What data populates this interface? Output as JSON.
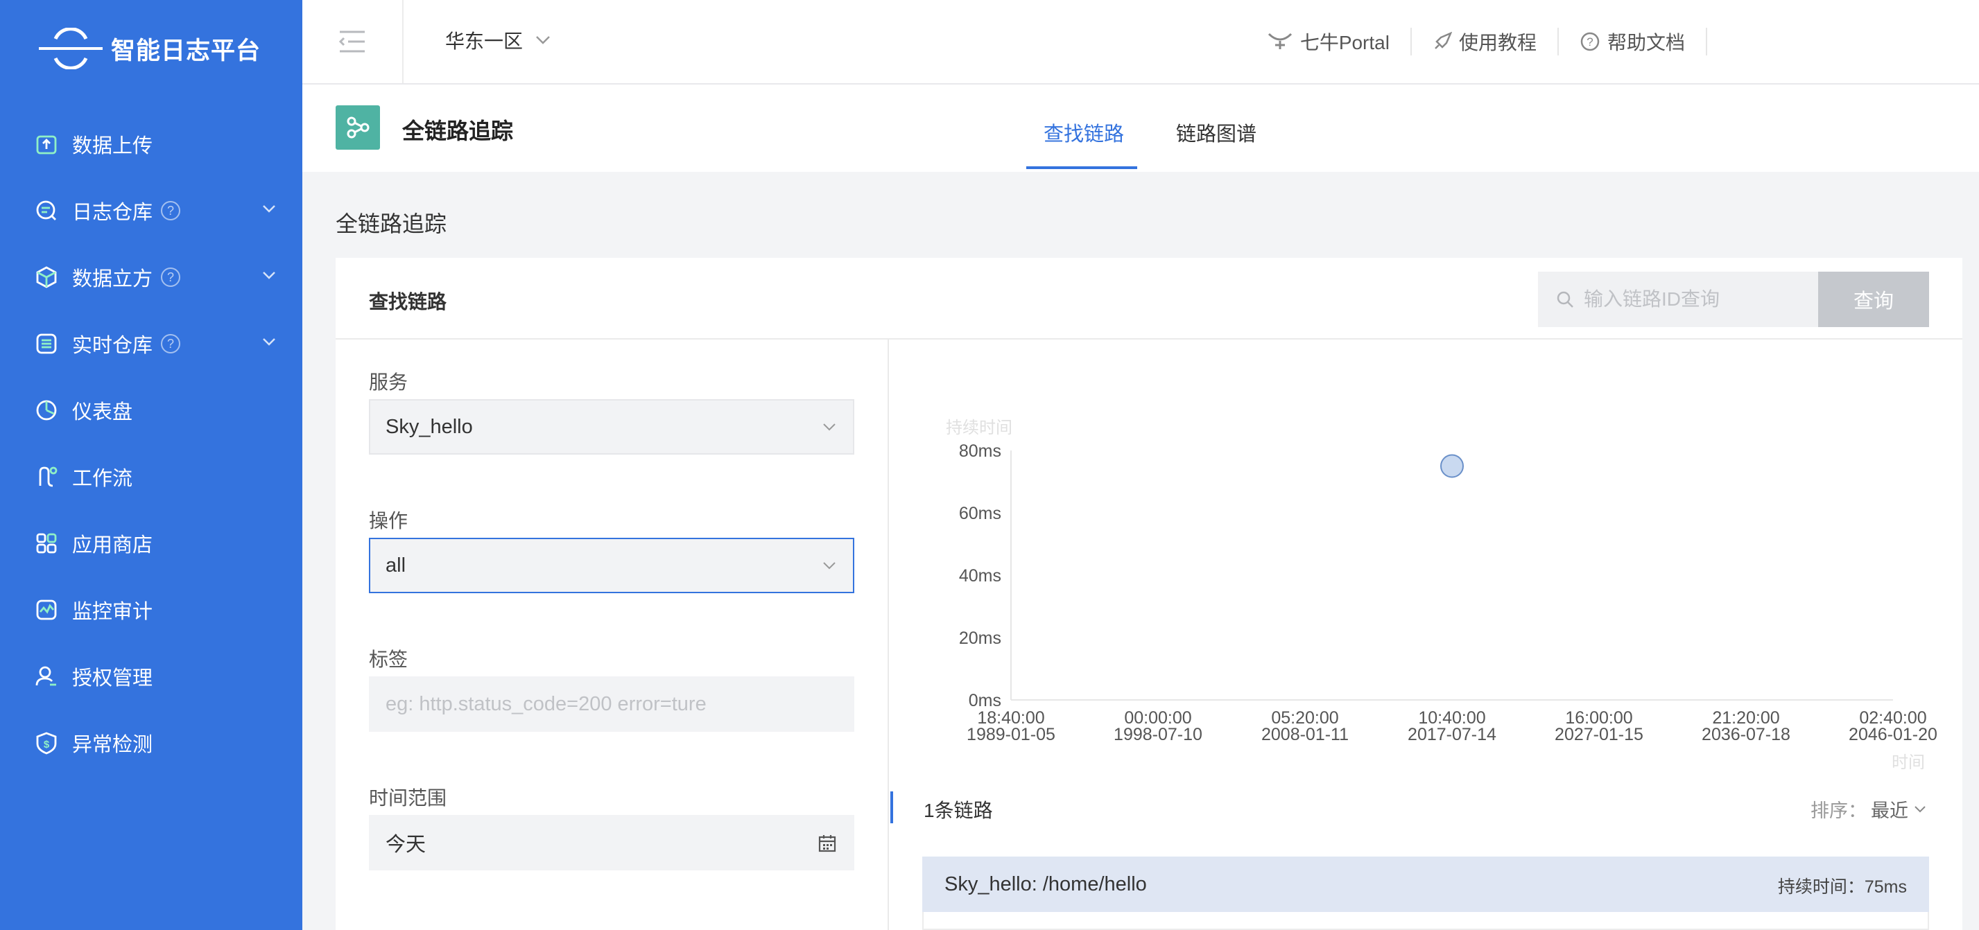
{
  "app": {
    "name": "智能日志平台"
  },
  "sidebar": {
    "items": [
      {
        "label": "数据上传",
        "icon": "upload-icon",
        "has_help": false,
        "has_chevron": false
      },
      {
        "label": "日志仓库",
        "icon": "log-repo-icon",
        "has_help": true,
        "has_chevron": true
      },
      {
        "label": "数据立方",
        "icon": "cube-icon",
        "has_help": true,
        "has_chevron": true
      },
      {
        "label": "实时仓库",
        "icon": "realtime-icon",
        "has_help": true,
        "has_chevron": true
      },
      {
        "label": "仪表盘",
        "icon": "dashboard-icon",
        "has_help": false,
        "has_chevron": false
      },
      {
        "label": "工作流",
        "icon": "workflow-icon",
        "has_help": false,
        "has_chevron": false
      },
      {
        "label": "应用商店",
        "icon": "app-store-icon",
        "has_help": false,
        "has_chevron": false
      },
      {
        "label": "监控审计",
        "icon": "monitor-icon",
        "has_help": false,
        "has_chevron": false
      },
      {
        "label": "授权管理",
        "icon": "user-auth-icon",
        "has_help": false,
        "has_chevron": false
      },
      {
        "label": "异常检测",
        "icon": "anomaly-icon",
        "has_help": false,
        "has_chevron": false
      }
    ],
    "help_glyph": "?"
  },
  "header": {
    "region": "华东一区",
    "links": [
      {
        "label": "七牛Portal",
        "icon": "qiniu-icon"
      },
      {
        "label": "使用教程",
        "icon": "rocket-icon"
      },
      {
        "label": "帮助文档",
        "icon": "help-circle-icon"
      }
    ]
  },
  "subheader": {
    "title": "全链路追踪",
    "tabs": [
      {
        "label": "查找链路",
        "active": true
      },
      {
        "label": "链路图谱",
        "active": false
      }
    ]
  },
  "page": {
    "heading": "全链路追踪",
    "card_title": "查找链路",
    "search": {
      "placeholder": "输入链路ID查询",
      "button": "查询"
    }
  },
  "form": {
    "service": {
      "label": "服务",
      "value": "Sky_hello"
    },
    "operation": {
      "label": "操作",
      "value": "all"
    },
    "tags": {
      "label": "标签",
      "placeholder": "eg: http.status_code=200 error=ture"
    },
    "time_range": {
      "label": "时间范围",
      "value": "今天"
    }
  },
  "chart_data": {
    "type": "scatter",
    "ylabel": "持续时间",
    "xlabel": "时间",
    "y_ticks": [
      "0ms",
      "20ms",
      "40ms",
      "60ms",
      "80ms"
    ],
    "ylim": [
      0,
      80
    ],
    "x_ticks": [
      {
        "time": "18:40:00",
        "date": "1989-01-05"
      },
      {
        "time": "00:00:00",
        "date": "1998-07-10"
      },
      {
        "time": "05:20:00",
        "date": "2008-01-11"
      },
      {
        "time": "10:40:00",
        "date": "2017-07-14"
      },
      {
        "time": "16:00:00",
        "date": "2027-01-15"
      },
      {
        "time": "21:20:00",
        "date": "2036-07-18"
      },
      {
        "time": "02:40:00",
        "date": "2046-01-20"
      }
    ],
    "points": [
      {
        "x": "2017-07-14 10:40:00",
        "y": 75
      }
    ],
    "point_color": "#c9d9f0",
    "point_stroke": "#6a90c9"
  },
  "traces": {
    "count_label": "1条链路",
    "sort_label": "排序：",
    "sort_value": "最近",
    "items": [
      {
        "name": "Sky_hello: /home/hello",
        "duration": "持续时间：75ms"
      }
    ]
  },
  "colors": {
    "sidebar": "#3473de",
    "accent": "#3473de",
    "app_icon": "#4fb3a3"
  }
}
